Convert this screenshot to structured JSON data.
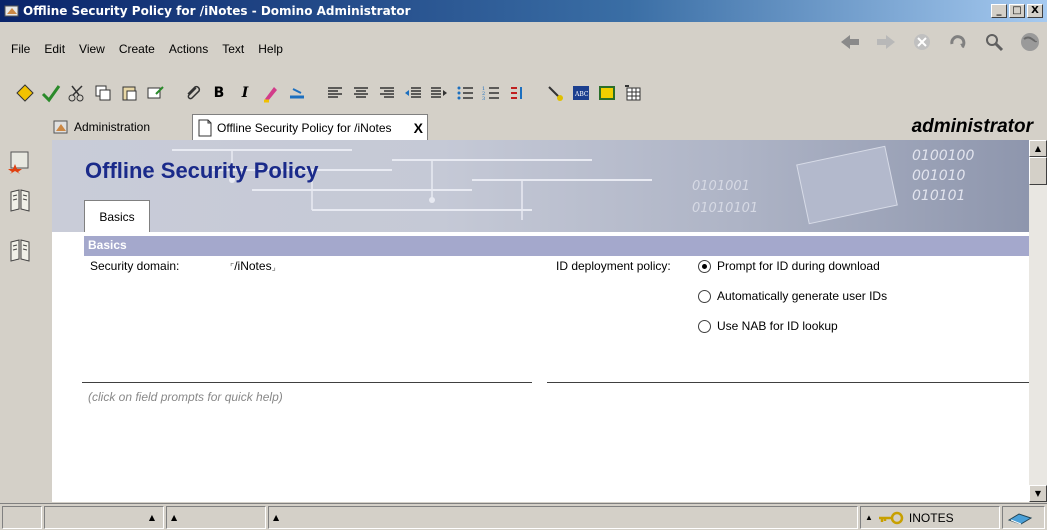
{
  "window": {
    "title": "Offline Security Policy for /iNotes - Domino Administrator",
    "controls": [
      "_",
      "□",
      "X"
    ]
  },
  "menu": {
    "items": [
      "File",
      "Edit",
      "View",
      "Create",
      "Actions",
      "Text",
      "Help"
    ]
  },
  "tabs": {
    "admin_label": "Administration",
    "doc_label": "Offline Security Policy for /iNotes",
    "close_label": "X"
  },
  "user": {
    "name": "administrator"
  },
  "toolbar": {
    "bold": "B",
    "italic": "I"
  },
  "form": {
    "banner_title": "Offline Security Policy",
    "banner_tab": "Basics",
    "section_title": "Basics",
    "security_domain_label": "Security domain:",
    "security_domain_value": "/iNotes",
    "id_deploy_label": "ID deployment policy:",
    "radio_options": [
      {
        "label": "Prompt for ID during download",
        "selected": true
      },
      {
        "label": "Automatically generate user IDs",
        "selected": false
      },
      {
        "label": "Use NAB for ID lookup",
        "selected": false
      }
    ],
    "help_text": "(click on field prompts for quick help)"
  },
  "status": {
    "location": "INOTES"
  },
  "colors": {
    "title_gradient_start": "#0a246a",
    "banner_title": "#1a2a8a",
    "section_bar": "#a4a8cc",
    "chrome": "#d4d0c8"
  }
}
